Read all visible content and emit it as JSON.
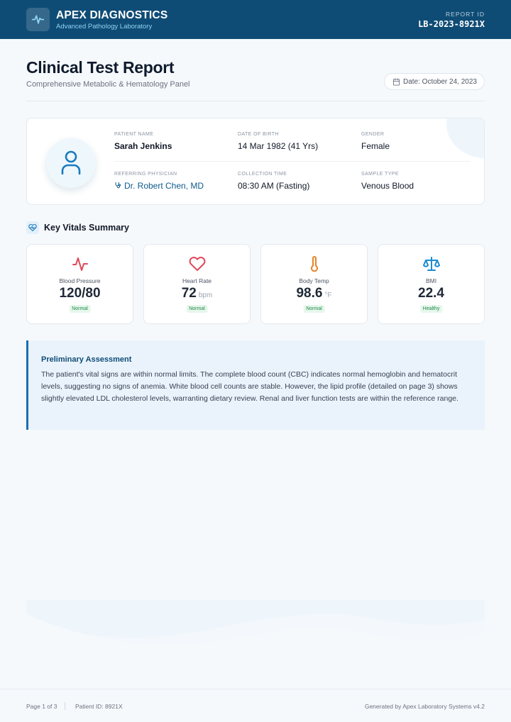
{
  "header": {
    "brand": "APEX DIAGNOSTICS",
    "tagline": "Advanced Pathology Laboratory",
    "report_id_label": "REPORT ID",
    "report_id": "LB-2023-8921X",
    "logo_icon": "pulse-icon",
    "background_color": "#0f4c75"
  },
  "report": {
    "title": "Clinical Test Report",
    "subtitle": "Comprehensive Metabolic & Hematology Panel",
    "date": "Date: October 24, 2023",
    "date_icon": "calendar-icon"
  },
  "patient": {
    "avatar_icon": "user-icon",
    "name_label": "PATIENT NAME",
    "name": "Sarah Jenkins",
    "dob_label": "DATE OF BIRTH",
    "dob": "14 Mar 1982 (41 Yrs)",
    "gender_label": "GENDER",
    "gender": "Female",
    "physician_label": "REFERRING PHYSICIAN",
    "physician": "Dr. Robert Chen, MD",
    "physician_icon": "stethoscope-icon",
    "collection_label": "COLLECTION TIME",
    "collection_time": "08:30 AM (Fasting)",
    "sample_label": "SAMPLE TYPE",
    "sample_type": "Venous Blood"
  },
  "vitals": {
    "section_title": "Key Vitals Summary",
    "section_icon": "heart-pulse-icon",
    "items": [
      {
        "label": "Blood Pressure",
        "value": "120/80",
        "unit": "",
        "status": "Normal",
        "icon": "activity-icon",
        "color": "#e0485a"
      },
      {
        "label": "Heart Rate",
        "value": "72",
        "unit": "bpm",
        "status": "Normal",
        "icon": "heart-icon",
        "color": "#e0485a"
      },
      {
        "label": "Body Temp",
        "value": "98.6",
        "unit": "°F",
        "status": "Normal",
        "icon": "thermometer-icon",
        "color": "#e8852a"
      },
      {
        "label": "BMI",
        "value": "22.4",
        "unit": "",
        "status": "Healthy",
        "icon": "scale-icon",
        "color": "#1b8bd1"
      }
    ]
  },
  "assessment": {
    "title": "Preliminary Assessment",
    "body": "The patient's vital signs are within normal limits. The complete blood count (CBC) indicates normal hemoglobin and hematocrit levels, suggesting no signs of anemia. White blood cell counts are stable. However, the lipid profile (detailed on page 3) shows slightly elevated LDL cholesterol levels, warranting dietary review. Renal and liver function tests are within the reference range."
  },
  "footer": {
    "page": "Page 1 of 3",
    "patient_id": "Patient ID: 8921X",
    "generated": "Generated by Apex Laboratory Systems v4.2"
  }
}
